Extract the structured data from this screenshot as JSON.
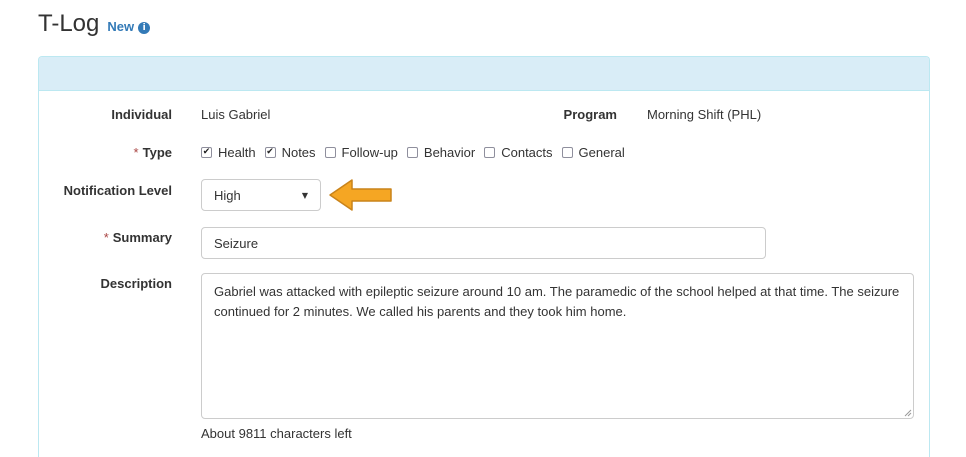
{
  "header": {
    "title": "T-Log",
    "badge": "New",
    "info_icon": "info-circle-icon"
  },
  "form": {
    "individual": {
      "label": "Individual",
      "value": "Luis Gabriel"
    },
    "program": {
      "label": "Program",
      "value": "Morning Shift (PHL)"
    },
    "type": {
      "label": "Type",
      "required": "*",
      "options": [
        {
          "label": "Health",
          "checked": true
        },
        {
          "label": "Notes",
          "checked": true
        },
        {
          "label": "Follow-up",
          "checked": false
        },
        {
          "label": "Behavior",
          "checked": false
        },
        {
          "label": "Contacts",
          "checked": false
        },
        {
          "label": "General",
          "checked": false
        }
      ]
    },
    "notification": {
      "label": "Notification Level",
      "selected": "High"
    },
    "summary": {
      "label": "Summary",
      "required": "*",
      "value": "Seizure"
    },
    "description": {
      "label": "Description",
      "value": "Gabriel was attacked with epileptic seizure around 10 am. The paramedic of the school helped at that time. The seizure continued for 2 minutes. We called his parents and they took him home.",
      "chars_left": "About 9811 characters left"
    }
  },
  "annotation": {
    "arrow_icon": "left-arrow-icon",
    "color": "#f5a623"
  },
  "colors": {
    "panel_heading": "#d9edf7",
    "panel_border": "#bce8f1",
    "accent": "#337ab7",
    "required": "#a94442"
  }
}
